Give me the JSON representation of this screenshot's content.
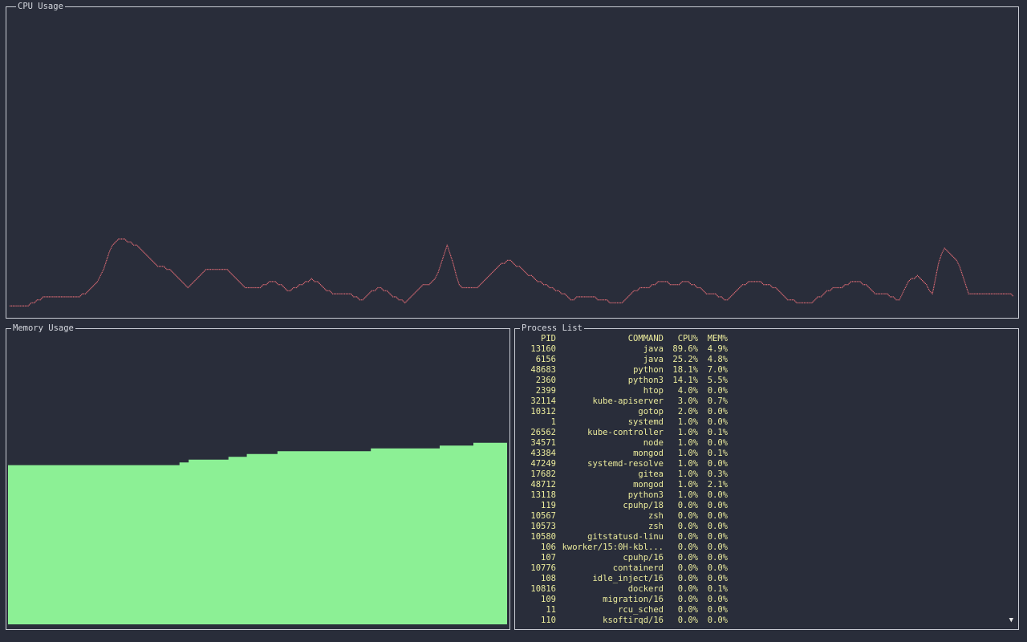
{
  "cpu_panel": {
    "title": "CPU Usage",
    "line_color": "#e06c75",
    "history": [
      3,
      3,
      3,
      3,
      3,
      3,
      3,
      4,
      4,
      5,
      5,
      6,
      6,
      6,
      6,
      6,
      6,
      6,
      6,
      6,
      6,
      6,
      6,
      6,
      7,
      7,
      8,
      9,
      10,
      11,
      13,
      15,
      18,
      21,
      23,
      24,
      25,
      25,
      25,
      24,
      24,
      23,
      23,
      22,
      21,
      20,
      19,
      18,
      17,
      16,
      16,
      16,
      15,
      15,
      14,
      13,
      12,
      11,
      10,
      9,
      10,
      11,
      12,
      13,
      14,
      15,
      15,
      15,
      15,
      15,
      15,
      15,
      15,
      14,
      13,
      12,
      11,
      10,
      9,
      9,
      9,
      9,
      9,
      9,
      10,
      10,
      11,
      11,
      11,
      10,
      10,
      9,
      8,
      8,
      9,
      9,
      10,
      10,
      11,
      11,
      12,
      11,
      11,
      10,
      9,
      8,
      8,
      7,
      7,
      7,
      7,
      7,
      7,
      7,
      6,
      6,
      5,
      5,
      6,
      7,
      8,
      8,
      9,
      9,
      8,
      8,
      7,
      6,
      6,
      5,
      5,
      4,
      5,
      6,
      7,
      8,
      9,
      10,
      10,
      10,
      11,
      12,
      14,
      17,
      20,
      23,
      20,
      17,
      13,
      10,
      9,
      9,
      9,
      9,
      9,
      9,
      10,
      11,
      12,
      13,
      14,
      15,
      16,
      17,
      17,
      18,
      18,
      17,
      16,
      16,
      15,
      14,
      13,
      13,
      12,
      11,
      11,
      10,
      10,
      9,
      9,
      8,
      8,
      7,
      7,
      6,
      5,
      5,
      6,
      6,
      6,
      6,
      6,
      6,
      6,
      5,
      5,
      5,
      5,
      4,
      4,
      4,
      4,
      4,
      5,
      6,
      7,
      8,
      8,
      9,
      9,
      9,
      9,
      10,
      10,
      11,
      11,
      11,
      11,
      10,
      10,
      10,
      10,
      11,
      11,
      11,
      10,
      10,
      9,
      9,
      8,
      7,
      7,
      7,
      7,
      6,
      6,
      5,
      5,
      6,
      7,
      8,
      9,
      10,
      10,
      11,
      11,
      11,
      11,
      11,
      10,
      10,
      10,
      9,
      9,
      8,
      7,
      6,
      5,
      5,
      5,
      4,
      4,
      4,
      4,
      4,
      4,
      5,
      6,
      6,
      7,
      8,
      8,
      9,
      9,
      9,
      9,
      10,
      10,
      11,
      11,
      11,
      11,
      10,
      10,
      9,
      8,
      7,
      7,
      7,
      7,
      7,
      6,
      6,
      5,
      5,
      7,
      9,
      11,
      12,
      12,
      13,
      12,
      11,
      10,
      8,
      7,
      12,
      17,
      20,
      22,
      21,
      20,
      19,
      18,
      16,
      13,
      10,
      7,
      7,
      7,
      7,
      7,
      7,
      7,
      7,
      7,
      7,
      7,
      7,
      7,
      7,
      7,
      6
    ]
  },
  "memory_panel": {
    "title": "Memory Usage",
    "fill_color": "#8cf095",
    "history": [
      57,
      57,
      57,
      57,
      57,
      57,
      57,
      57,
      57,
      57,
      57,
      57,
      57,
      57,
      57,
      57,
      57,
      57,
      57,
      57,
      57,
      57,
      57,
      57,
      57,
      57,
      57,
      57,
      57,
      57,
      57,
      57,
      57,
      57,
      57,
      57,
      57,
      57,
      57,
      57,
      57,
      57,
      57,
      57,
      57,
      57,
      57,
      57,
      57,
      57,
      57,
      57,
      57,
      57,
      57,
      57,
      57,
      57,
      57,
      57,
      57,
      57,
      57,
      57,
      57,
      57,
      57,
      57,
      57,
      57,
      57,
      57,
      57,
      57,
      57,
      57,
      57,
      57,
      57,
      57,
      57,
      57,
      57,
      57,
      57,
      57,
      57,
      57,
      57,
      57,
      57,
      57,
      57,
      57,
      57,
      57,
      57,
      57,
      57,
      57,
      57,
      57,
      57,
      57,
      57,
      57,
      57,
      57,
      57,
      57,
      57,
      57,
      58,
      58,
      58,
      58,
      58,
      58,
      59,
      59,
      59,
      59,
      59,
      59,
      59,
      59,
      59,
      59,
      59,
      59,
      59,
      59,
      59,
      59,
      59,
      59,
      59,
      59,
      59,
      59,
      59,
      59,
      59,
      59,
      60,
      60,
      60,
      60,
      60,
      60,
      60,
      60,
      60,
      60,
      60,
      60,
      61,
      61,
      61,
      61,
      61,
      61,
      61,
      61,
      61,
      61,
      61,
      61,
      61,
      61,
      61,
      61,
      61,
      61,
      61,
      61,
      62,
      62,
      62,
      62,
      62,
      62,
      62,
      62,
      62,
      62,
      62,
      62,
      62,
      62,
      62,
      62,
      62,
      62,
      62,
      62,
      62,
      62,
      62,
      62,
      62,
      62,
      62,
      62,
      62,
      62,
      62,
      62,
      62,
      62,
      62,
      62,
      62,
      62,
      62,
      62,
      62,
      62,
      62,
      62,
      62,
      62,
      62,
      62,
      62,
      62,
      62,
      62,
      62,
      62,
      62,
      62,
      62,
      62,
      62,
      62,
      62,
      63,
      63,
      63,
      63,
      63,
      63,
      63,
      63,
      63,
      63,
      63,
      63,
      63,
      63,
      63,
      63,
      63,
      63,
      63,
      63,
      63,
      63,
      63,
      63,
      63,
      63,
      63,
      63,
      63,
      63,
      63,
      63,
      63,
      63,
      63,
      63,
      63,
      63,
      63,
      63,
      63,
      63,
      63,
      63,
      63,
      64,
      64,
      64,
      64,
      64,
      64,
      64,
      64,
      64,
      64,
      64,
      64,
      64,
      64,
      64,
      64,
      64,
      64,
      64,
      64,
      64,
      64,
      65,
      65,
      65,
      65,
      65,
      65,
      65,
      65,
      65,
      65,
      65,
      65,
      65,
      65,
      65,
      65,
      65,
      65,
      65,
      65,
      65,
      65
    ]
  },
  "process_panel": {
    "title": "Process List",
    "text_color": "#ecec9c",
    "columns": {
      "pid": "PID",
      "command": "COMMAND",
      "cpu": "CPU%",
      "mem": "MEM%"
    },
    "rows": [
      {
        "pid": "13160",
        "command": "java",
        "cpu": "89.6%",
        "mem": "4.9%"
      },
      {
        "pid": "6156",
        "command": "java",
        "cpu": "25.2%",
        "mem": "4.8%"
      },
      {
        "pid": "48683",
        "command": "python",
        "cpu": "18.1%",
        "mem": "7.0%"
      },
      {
        "pid": "2360",
        "command": "python3",
        "cpu": "14.1%",
        "mem": "5.5%"
      },
      {
        "pid": "2399",
        "command": "htop",
        "cpu": "4.0%",
        "mem": "0.0%"
      },
      {
        "pid": "32114",
        "command": "kube-apiserver",
        "cpu": "3.0%",
        "mem": "0.7%"
      },
      {
        "pid": "10312",
        "command": "gotop",
        "cpu": "2.0%",
        "mem": "0.0%"
      },
      {
        "pid": "1",
        "command": "systemd",
        "cpu": "1.0%",
        "mem": "0.0%"
      },
      {
        "pid": "26562",
        "command": "kube-controller",
        "cpu": "1.0%",
        "mem": "0.1%"
      },
      {
        "pid": "34571",
        "command": "node",
        "cpu": "1.0%",
        "mem": "0.0%"
      },
      {
        "pid": "43384",
        "command": "mongod",
        "cpu": "1.0%",
        "mem": "0.1%"
      },
      {
        "pid": "47249",
        "command": "systemd-resolve",
        "cpu": "1.0%",
        "mem": "0.0%"
      },
      {
        "pid": "17682",
        "command": "gitea",
        "cpu": "1.0%",
        "mem": "0.3%"
      },
      {
        "pid": "48712",
        "command": "mongod",
        "cpu": "1.0%",
        "mem": "2.1%"
      },
      {
        "pid": "13118",
        "command": "python3",
        "cpu": "1.0%",
        "mem": "0.0%"
      },
      {
        "pid": "119",
        "command": "cpuhp/18",
        "cpu": "0.0%",
        "mem": "0.0%"
      },
      {
        "pid": "10567",
        "command": "zsh",
        "cpu": "0.0%",
        "mem": "0.0%"
      },
      {
        "pid": "10573",
        "command": "zsh",
        "cpu": "0.0%",
        "mem": "0.0%"
      },
      {
        "pid": "10580",
        "command": "gitstatusd-linu",
        "cpu": "0.0%",
        "mem": "0.0%"
      },
      {
        "pid": "106",
        "command": "kworker/15:0H-kbl...",
        "cpu": "0.0%",
        "mem": "0.0%"
      },
      {
        "pid": "107",
        "command": "cpuhp/16",
        "cpu": "0.0%",
        "mem": "0.0%"
      },
      {
        "pid": "10776",
        "command": "containerd",
        "cpu": "0.0%",
        "mem": "0.0%"
      },
      {
        "pid": "108",
        "command": "idle_inject/16",
        "cpu": "0.0%",
        "mem": "0.0%"
      },
      {
        "pid": "10816",
        "command": "dockerd",
        "cpu": "0.0%",
        "mem": "0.1%"
      },
      {
        "pid": "109",
        "command": "migration/16",
        "cpu": "0.0%",
        "mem": "0.0%"
      },
      {
        "pid": "11",
        "command": "rcu_sched",
        "cpu": "0.0%",
        "mem": "0.0%"
      },
      {
        "pid": "110",
        "command": "ksoftirqd/16",
        "cpu": "0.0%",
        "mem": "0.0%"
      }
    ],
    "scroll_indicator": "▼"
  }
}
